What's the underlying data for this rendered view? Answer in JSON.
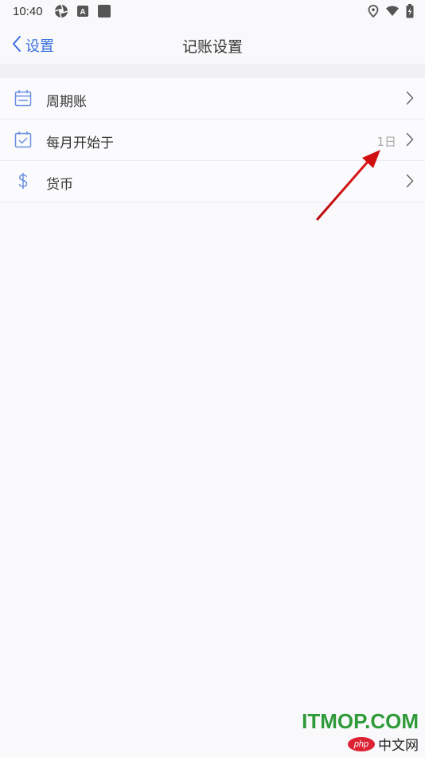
{
  "status_bar": {
    "time": "10:40",
    "left_icons": [
      "aperture-icon",
      "a-box-icon",
      "square-app-icon"
    ],
    "right_icons": [
      "location-pin-icon",
      "wifi-icon",
      "battery-charging-icon"
    ]
  },
  "nav": {
    "back_label": "设置",
    "title": "记账设置"
  },
  "settings": {
    "items": [
      {
        "label": "周期账",
        "value": "",
        "icon": "calendar-icon"
      },
      {
        "label": "每月开始于",
        "value": "1日",
        "icon": "calendar-check-icon"
      },
      {
        "label": "货币",
        "value": "",
        "icon": "dollar-icon"
      }
    ]
  },
  "colors": {
    "accent": "#3b6fe0",
    "annotation_arrow": "#d01010",
    "watermark_green": "#2e9a3a"
  },
  "watermark": {
    "brand": "ITMOP.COM",
    "logo_text": "php",
    "sub_text": "中文网"
  }
}
